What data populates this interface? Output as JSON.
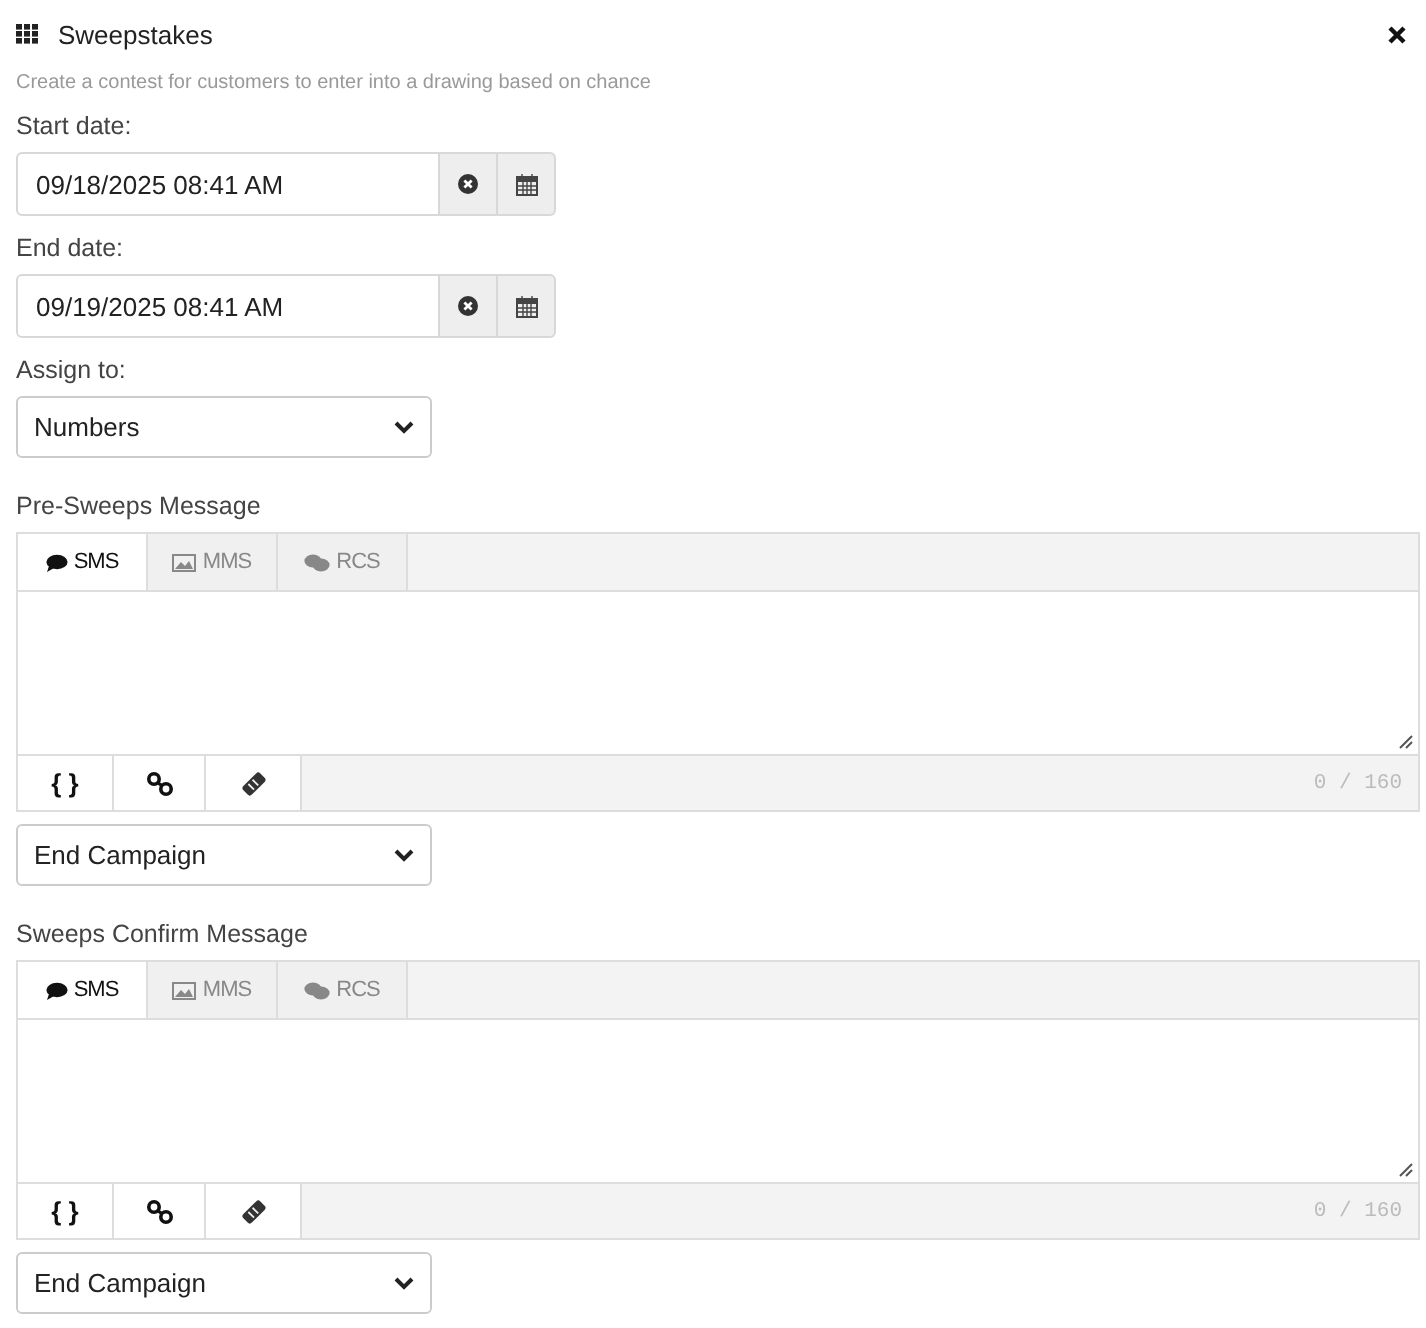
{
  "header": {
    "title": "Sweepstakes",
    "description": "Create a contest for customers to enter into a drawing based on chance"
  },
  "date_fields": [
    {
      "label": "Start date:",
      "value": "09/18/2025 08:41 AM"
    },
    {
      "label": "End date:",
      "value": "09/19/2025 08:41 AM"
    }
  ],
  "assign_to": {
    "label": "Assign to:",
    "value": "Numbers"
  },
  "messages": [
    {
      "label": "Pre-Sweeps Message",
      "tabs": [
        {
          "kind": "sms",
          "label": "SMS",
          "selected": true
        },
        {
          "kind": "mms",
          "label": "MMS",
          "selected": false
        },
        {
          "kind": "rcs",
          "label": "RCS",
          "selected": false
        }
      ],
      "tools": [
        {
          "kind": "variables",
          "label": "{ }"
        },
        {
          "kind": "link"
        },
        {
          "kind": "tag"
        }
      ],
      "counter": "0 / 160",
      "action": "End Campaign"
    },
    {
      "label": "Sweeps Confirm Message",
      "tabs": [
        {
          "kind": "sms",
          "label": "SMS",
          "selected": true
        },
        {
          "kind": "mms",
          "label": "MMS",
          "selected": false
        },
        {
          "kind": "rcs",
          "label": "RCS",
          "selected": false
        }
      ],
      "tools": [
        {
          "kind": "variables",
          "label": "{ }"
        },
        {
          "kind": "link"
        },
        {
          "kind": "tag"
        }
      ],
      "counter": "0 / 160",
      "action": "End Campaign"
    }
  ]
}
